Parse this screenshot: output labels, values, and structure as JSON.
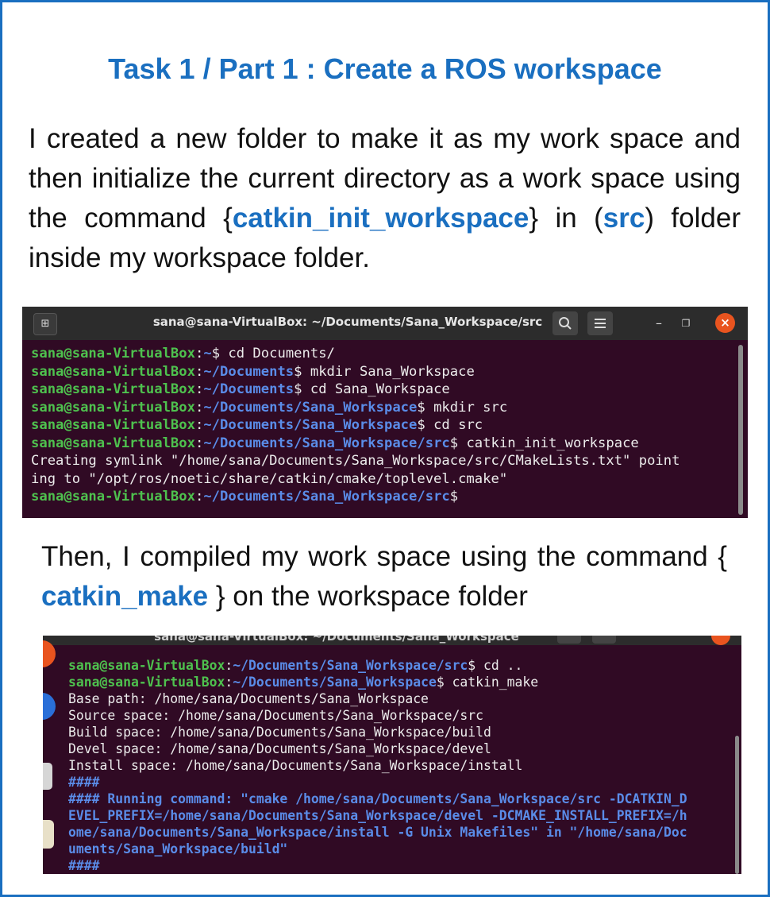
{
  "title": "Task 1 / Part 1 : Create a ROS workspace",
  "paragraph1": {
    "part1": "I created a new folder to make it as my work space and then initialize the current directory as a work space using the command {",
    "cmd": "catkin_init_workspace",
    "part2": "} in (",
    "folder": "src",
    "part3": ") folder inside my workspace folder."
  },
  "terminal1": {
    "title": "sana@sana-VirtualBox: ~/Documents/Sana_Workspace/src",
    "lines": [
      {
        "user": "sana@sana-VirtualBox",
        "path": "~",
        "cmd": "$ cd Documents/"
      },
      {
        "user": "sana@sana-VirtualBox",
        "path": "~/Documents",
        "cmd": "$ mkdir Sana_Workspace"
      },
      {
        "user": "sana@sana-VirtualBox",
        "path": "~/Documents",
        "cmd": "$ cd Sana_Workspace"
      },
      {
        "user": "sana@sana-VirtualBox",
        "path": "~/Documents/Sana_Workspace",
        "cmd": "$ mkdir src"
      },
      {
        "user": "sana@sana-VirtualBox",
        "path": "~/Documents/Sana_Workspace",
        "cmd": "$ cd src"
      },
      {
        "user": "sana@sana-VirtualBox",
        "path": "~/Documents/Sana_Workspace/src",
        "cmd": "$ catkin_init_workspace"
      }
    ],
    "output1": "Creating symlink \"/home/sana/Documents/Sana_Workspace/src/CMakeLists.txt\" point",
    "output2": "ing to \"/opt/ros/noetic/share/catkin/cmake/toplevel.cmake\"",
    "last": {
      "user": "sana@sana-VirtualBox",
      "path": "~/Documents/Sana_Workspace/src",
      "cmd": "$"
    },
    "new_tab_icon": "new-tab-icon",
    "search_icon": "search-icon",
    "menu_icon": "hamburger-menu-icon",
    "minimize": "–",
    "maximize": "❐",
    "close": "×"
  },
  "paragraph2": {
    "part1": "Then, I compiled my work space using the command {",
    "cmd": "catkin_make",
    "part2": "} on the workspace folder"
  },
  "terminal2": {
    "title": "sana@sana-VirtualBox: ~/Documents/Sana_Workspace",
    "line1": {
      "user": "sana@sana-VirtualBox",
      "path": "~/Documents/Sana_Workspace/src",
      "cmd": "$ cd .."
    },
    "line2": {
      "user": "sana@sana-VirtualBox",
      "path": "~/Documents/Sana_Workspace",
      "cmd": "$ catkin_make"
    },
    "outputs": [
      "Base path: /home/sana/Documents/Sana_Workspace",
      "Source space: /home/sana/Documents/Sana_Workspace/src",
      "Build space: /home/sana/Documents/Sana_Workspace/build",
      "Devel space: /home/sana/Documents/Sana_Workspace/devel",
      "Install space: /home/sana/Documents/Sana_Workspace/install"
    ],
    "hash1": "####",
    "running": [
      "#### Running command: \"cmake /home/sana/Documents/Sana_Workspace/src -DCATKIN_D",
      "EVEL_PREFIX=/home/sana/Documents/Sana_Workspace/devel -DCMAKE_INSTALL_PREFIX=/h",
      "ome/sana/Documents/Sana_Workspace/install -G Unix Makefiles\" in \"/home/sana/Doc",
      "uments/Sana_Workspace/build\""
    ],
    "hash2": "####"
  },
  "colors": {
    "accent": "#1a6fc0",
    "terminal_bg": "#300a24",
    "prompt_user": "#4ec14e",
    "prompt_path": "#5a8ce8",
    "close_button": "#e9541f"
  }
}
